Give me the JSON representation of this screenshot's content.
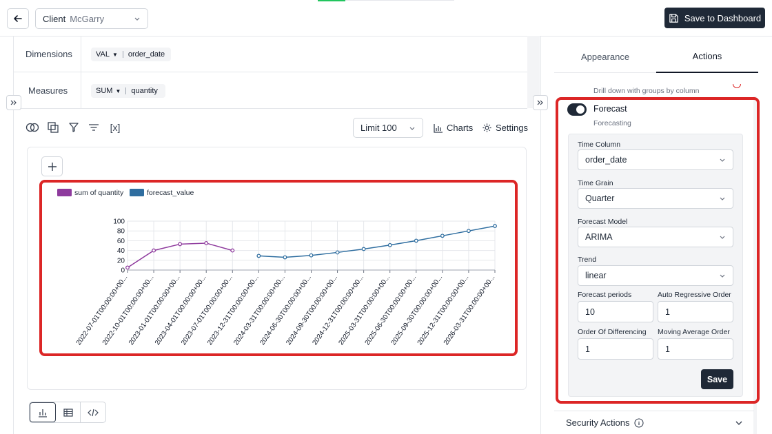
{
  "header": {
    "client_label": "Client",
    "client_value": "McGarry",
    "save_dashboard_label": "Save to Dashboard"
  },
  "query": {
    "dimensions_label": "Dimensions",
    "dimension_agg": "VAL",
    "dimension_field": "order_date",
    "measures_label": "Measures",
    "measure_agg": "SUM",
    "measure_field": "quantity"
  },
  "toolbar": {
    "limit_value": "Limit 100",
    "charts_label": "Charts",
    "settings_label": "Settings",
    "variable_label": "[x]"
  },
  "chart_data": {
    "type": "line",
    "x": [
      "2022-07-01T00:00:00+00...",
      "2022-10-01T00:00:00+00...",
      "2023-01-01T00:00:00+00...",
      "2023-04-01T00:00:00+00...",
      "2023-07-01T00:00:00+00...",
      "2023-12-31T00:00:00+00...",
      "2024-03-31T00:00:00+00...",
      "2024-06-30T00:00:00+00...",
      "2024-09-30T00:00:00+00...",
      "2024-12-31T00:00:00+00...",
      "2025-03-31T00:00:00+00...",
      "2025-06-30T00:00:00+00...",
      "2025-09-30T00:00:00+00...",
      "2025-12-31T00:00:00+00...",
      "2026-03-31T00:00:00+00..."
    ],
    "series": [
      {
        "name": "sum of quantity",
        "color": "#8e3a9d",
        "values": [
          5,
          40,
          53,
          55,
          40,
          null,
          null,
          null,
          null,
          null,
          null,
          null,
          null,
          null,
          null
        ]
      },
      {
        "name": "forecast_value",
        "color": "#2f6ea0",
        "values": [
          null,
          null,
          null,
          null,
          null,
          29,
          26,
          30,
          36,
          43,
          51,
          60,
          70,
          80,
          90
        ]
      }
    ],
    "yticks": [
      0,
      20,
      40,
      60,
      80,
      100
    ],
    "ylim": [
      0,
      100
    ],
    "grid": true,
    "legend": "top-left"
  },
  "panel": {
    "tabs": [
      {
        "label": "Appearance"
      },
      {
        "label": "Actions"
      }
    ],
    "drilldown_desc": "Drill down with groups by column",
    "forecast_title": "Forecast",
    "forecast_sub": "Forecasting",
    "time_column_label": "Time Column",
    "time_column_value": "order_date",
    "time_grain_label": "Time Grain",
    "time_grain_value": "Quarter",
    "model_label": "Forecast Model",
    "model_value": "ARIMA",
    "trend_label": "Trend",
    "trend_value": "linear",
    "periods_label": "Forecast periods",
    "periods_value": "10",
    "ar_label": "Auto Regressive Order",
    "ar_value": "1",
    "diff_label": "Order Of Differencing",
    "diff_value": "1",
    "ma_label": "Moving Average Order",
    "ma_value": "1",
    "save_label": "Save",
    "security_label": "Security Actions"
  }
}
